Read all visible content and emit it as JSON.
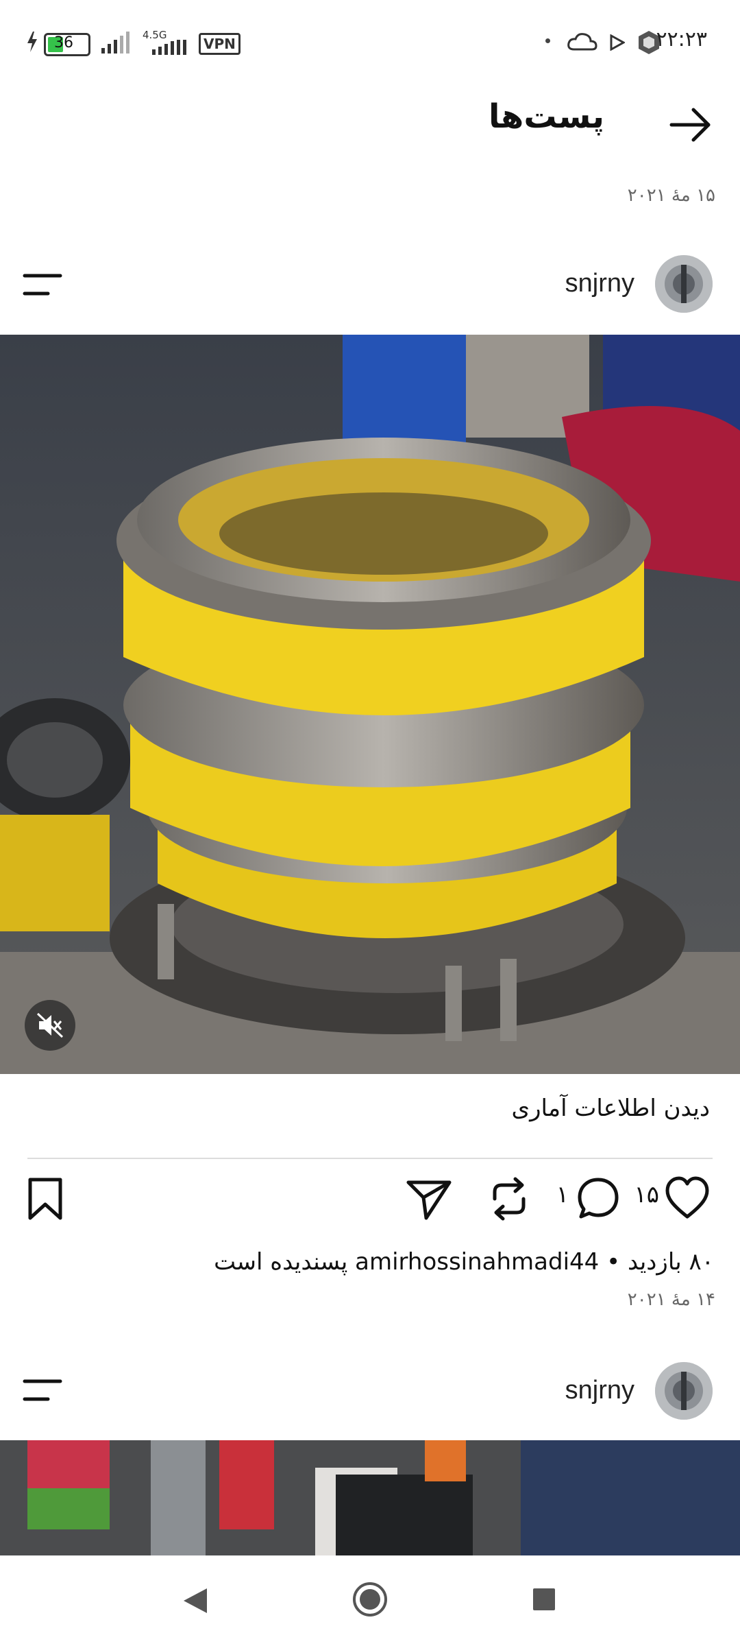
{
  "status_bar": {
    "time": "۲۲:۲۳",
    "battery": "36",
    "network_type": "4.5G",
    "vpn": "VPN",
    "icons": [
      "charging-icon",
      "battery-icon",
      "signal-icon",
      "signal-4-5g-icon",
      "vpn-icon",
      "dot-icon",
      "cloud-icon",
      "play-store-icon",
      "hexagon-app-icon"
    ]
  },
  "header": {
    "title": "پست‌ها",
    "back_icon": "arrow-right-icon",
    "date": "۱۵ مهٔ ۲۰۲۱"
  },
  "post1": {
    "username": "snjrny",
    "menu_icon": "menu-lines-icon",
    "media_description_icon": "muted-speaker-icon",
    "stats_link": "دیدن اطلاعات آماری",
    "likes": "۱۵",
    "comments": "۱",
    "actions": [
      "heart-icon",
      "comment-icon",
      "repost-icon",
      "send-icon",
      "bookmark-icon"
    ],
    "views_line": "۸۰ بازدید • amirhossinahmadi44 پسندیده است",
    "date": "۱۴ مهٔ ۲۰۲۱"
  },
  "post2": {
    "username": "snjrny",
    "menu_icon": "menu-lines-icon"
  },
  "nav_bar": {
    "icons": [
      "back-triangle-icon",
      "home-circle-icon",
      "recents-square-icon"
    ]
  },
  "colors": {
    "accent_yellow": "#e8c81a",
    "text_primary": "#111111",
    "text_secondary": "#666666"
  }
}
